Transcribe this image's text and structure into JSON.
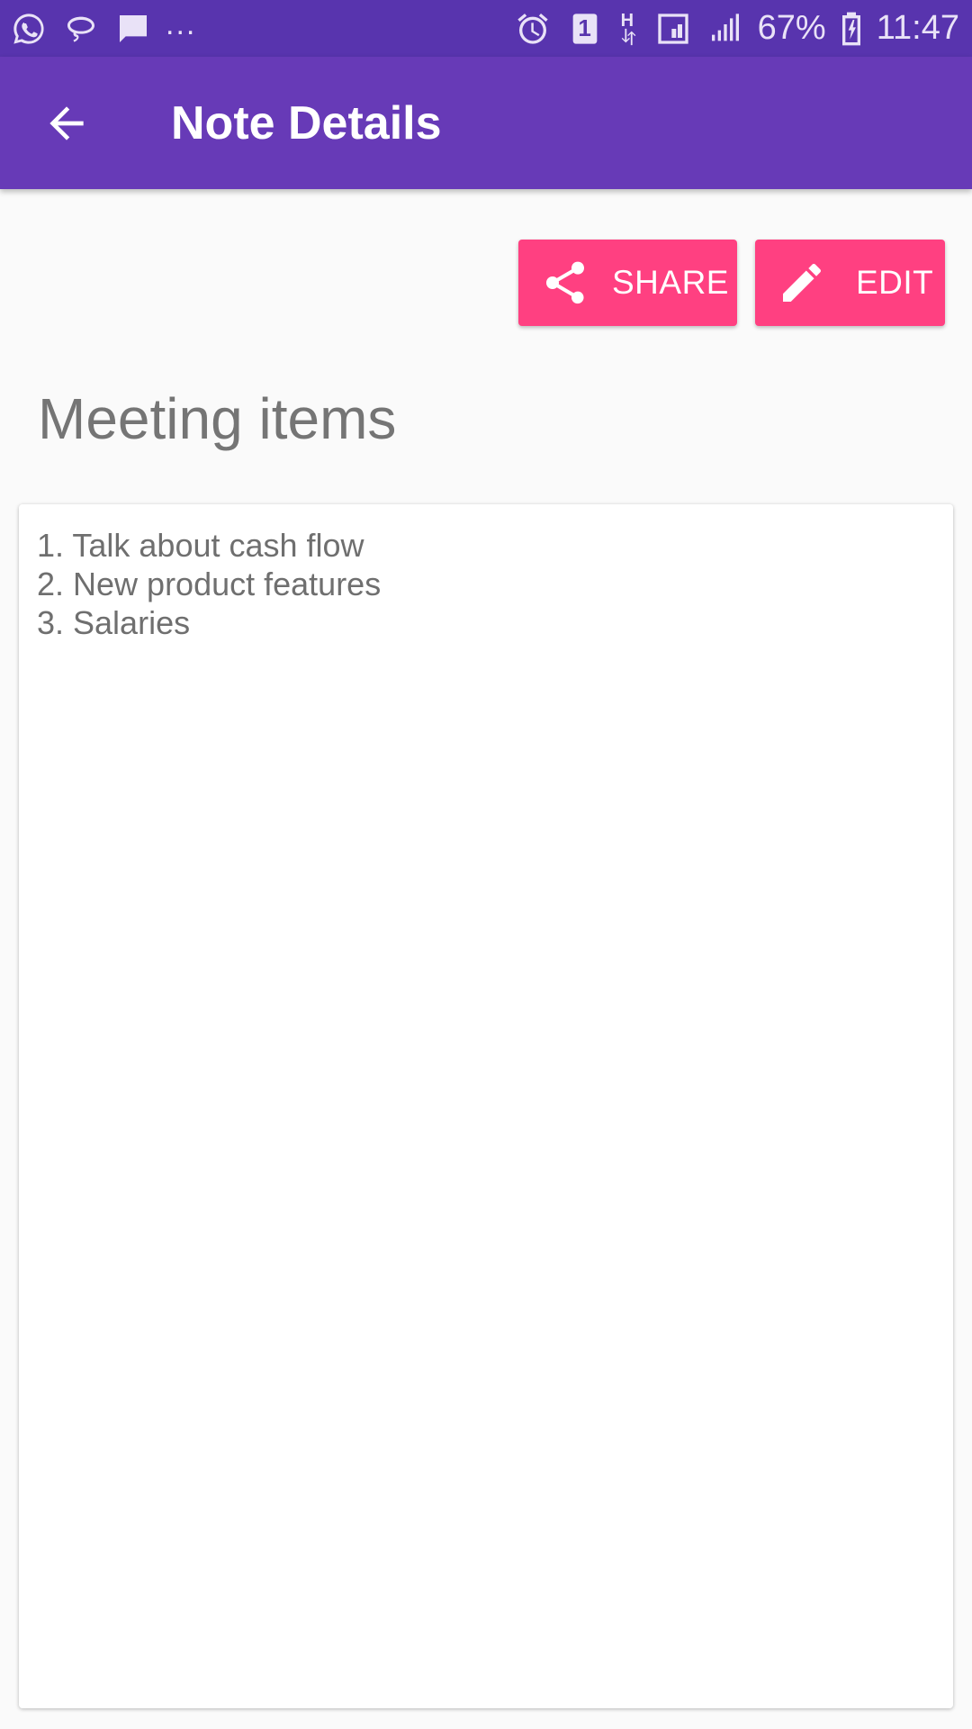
{
  "status_bar": {
    "more": "...",
    "battery": "67%",
    "time": "11:47",
    "sim_badge": "1",
    "network_type": "H",
    "left_icons": [
      "whatsapp-icon",
      "lasso-icon",
      "message-icon"
    ],
    "right_icons": [
      "alarm-icon",
      "sim-icon",
      "network-icon",
      "signal-icon",
      "battery-icon"
    ]
  },
  "app_bar": {
    "title": "Note Details",
    "back_icon": "arrow-back-icon"
  },
  "actions": {
    "share_label": "SHARE",
    "share_icon": "share-icon",
    "edit_label": "EDIT",
    "edit_icon": "pencil-icon"
  },
  "note": {
    "title": "Meeting items",
    "lines": [
      "1. Talk about cash flow",
      "2. New product features",
      "3. Salaries"
    ]
  },
  "colors": {
    "status_bar": "#5834ae",
    "primary": "#673ab7",
    "accent": "#ff4081",
    "background": "#fafafa",
    "text_secondary": "#757575"
  }
}
